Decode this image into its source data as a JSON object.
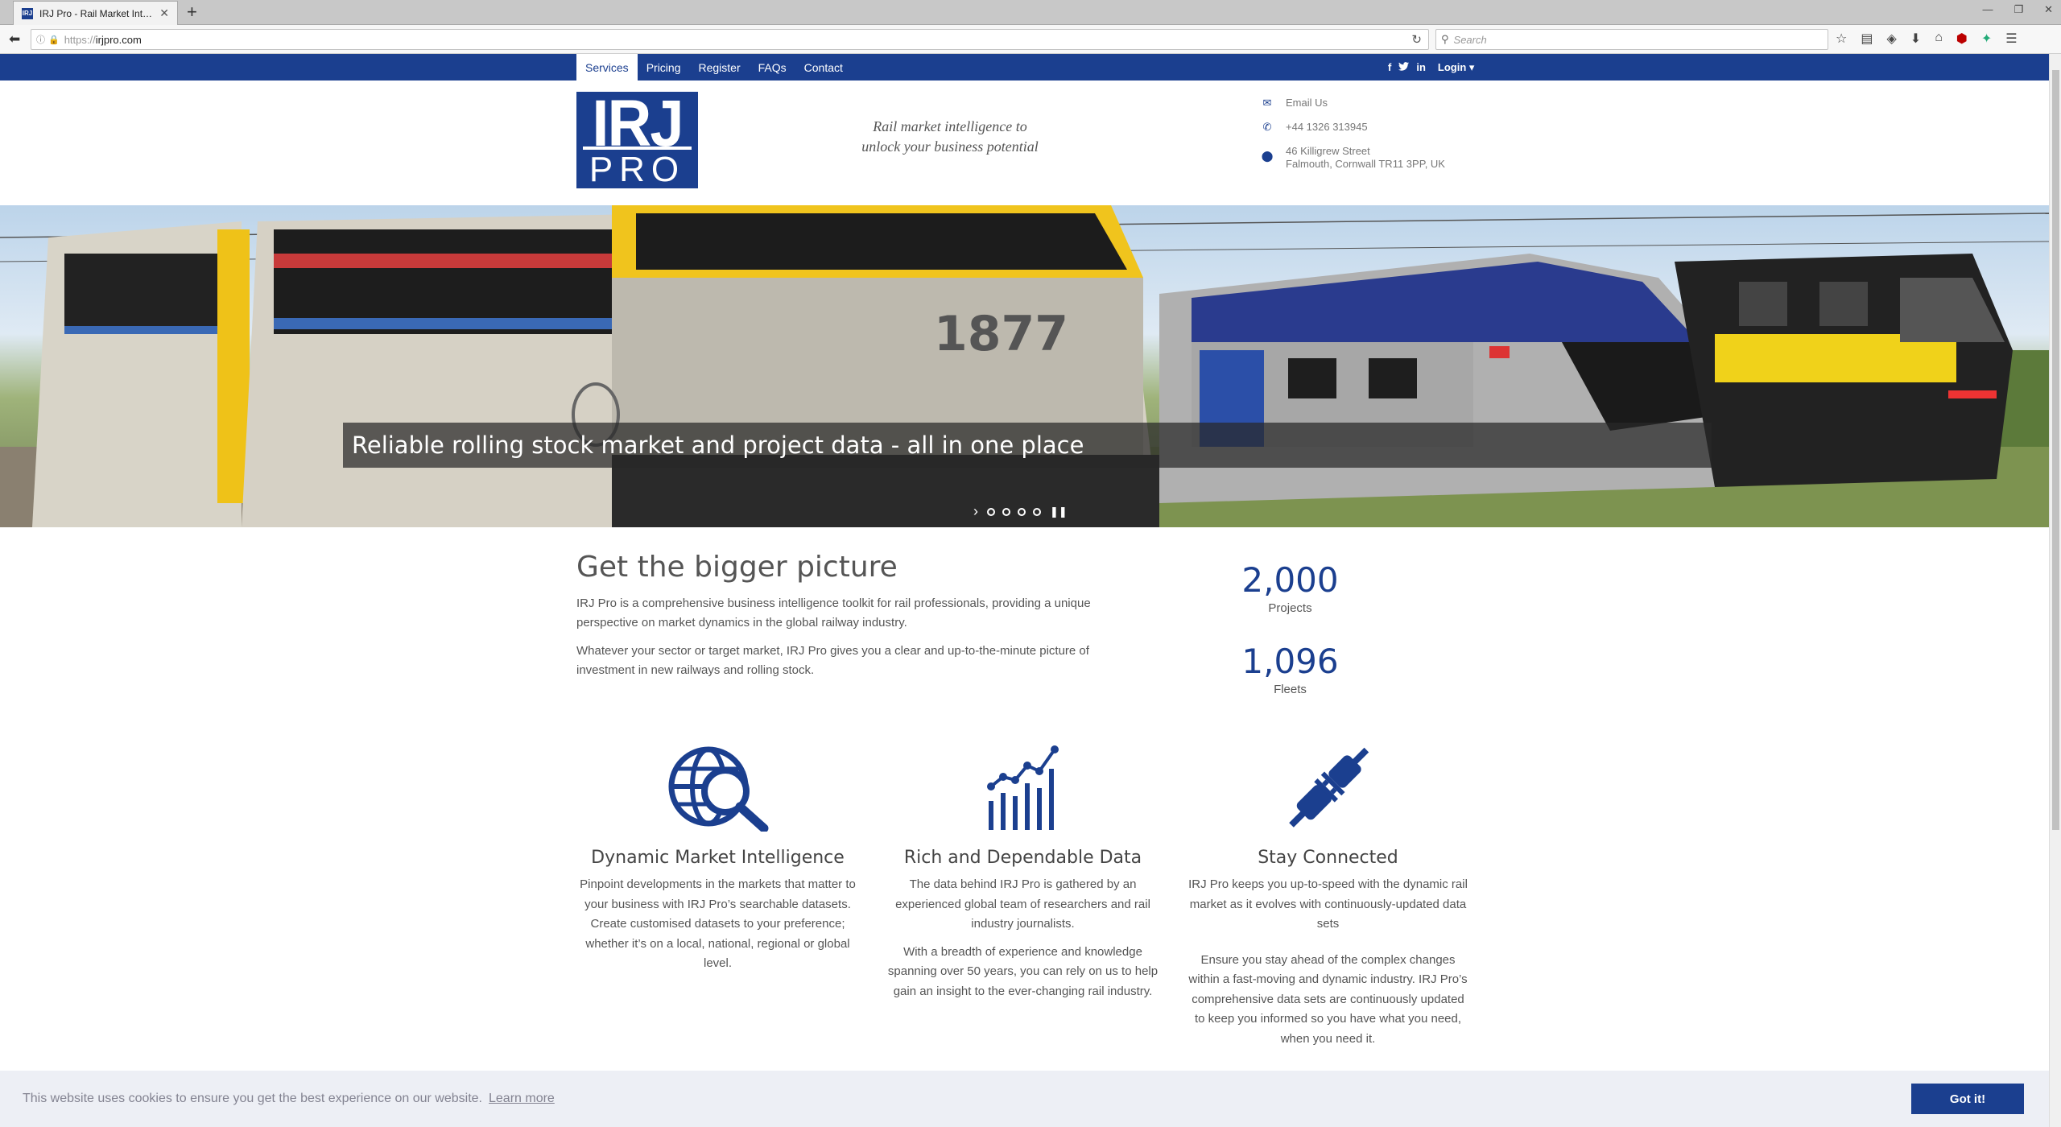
{
  "browser": {
    "tab_title": "IRJ Pro - Rail Market Intellige",
    "tab_favicon_text": "IRJ",
    "url": "https://irjpro.com",
    "url_scheme": "https://",
    "url_host": "irjpro.com",
    "search_placeholder": "Search"
  },
  "nav": {
    "items": [
      {
        "label": "Services",
        "active": true
      },
      {
        "label": "Pricing",
        "active": false
      },
      {
        "label": "Register",
        "active": false
      },
      {
        "label": "FAQs",
        "active": false
      },
      {
        "label": "Contact",
        "active": false
      }
    ],
    "social": {
      "facebook": "f",
      "twitter": "t",
      "linkedin": "in"
    },
    "login_label": "Login ▾"
  },
  "header": {
    "logo_top": "IRJ",
    "logo_bottom": "PRO",
    "tagline_line1": "Rail market intelligence to",
    "tagline_line2": "unlock your business potential",
    "contact": {
      "email": "Email Us",
      "phone": "+44 1326 313945",
      "address_line1": "46 Killigrew Street",
      "address_line2": "Falmouth, Cornwall TR11 3PP, UK"
    }
  },
  "hero": {
    "caption": "Reliable rolling stock market and project data - all in one place",
    "slides": 4,
    "loco_number": "1877"
  },
  "intro": {
    "heading": "Get the bigger picture",
    "para1": "IRJ Pro is a comprehensive business intelligence toolkit for rail professionals, providing a unique perspective on market dynamics in the global railway industry.",
    "para2": "Whatever your sector or target market, IRJ Pro gives you a clear and up-to-the-minute picture of investment in new railways and rolling stock."
  },
  "stats": [
    {
      "value": "2,000",
      "label": "Projects"
    },
    {
      "value": "1,096",
      "label": "Fleets"
    }
  ],
  "features": [
    {
      "icon": "globe-search-icon",
      "title": "Dynamic Market Intelligence",
      "paras": [
        "Pinpoint developments in the markets that matter to your business with IRJ Pro’s searchable datasets. Create customised datasets to your preference; whether it’s on a local, national, regional or global level."
      ]
    },
    {
      "icon": "bar-chart-icon",
      "title": "Rich and Dependable Data",
      "paras": [
        "The data behind IRJ Pro is gathered by an experienced global team of researchers and rail industry journalists.",
        "With a breadth of experience and knowledge spanning over 50 years, you can rely on us to help gain an insight to the ever-changing rail industry."
      ]
    },
    {
      "icon": "plug-icon",
      "title": "Stay Connected",
      "paras": [
        "IRJ Pro keeps you up-to-speed with the dynamic rail market as it evolves with continuously-updated data sets",
        "Ensure you stay ahead of the complex changes within a fast-moving and dynamic industry. IRJ Pro’s comprehensive data sets are continuously updated to keep you informed so you have what you need, when you need it."
      ]
    }
  ],
  "cookie": {
    "message": "This website uses cookies to ensure you get the best experience on our website.",
    "learn_more": "Learn more",
    "button": "Got it!"
  },
  "colors": {
    "brand": "#1b3f8f"
  }
}
